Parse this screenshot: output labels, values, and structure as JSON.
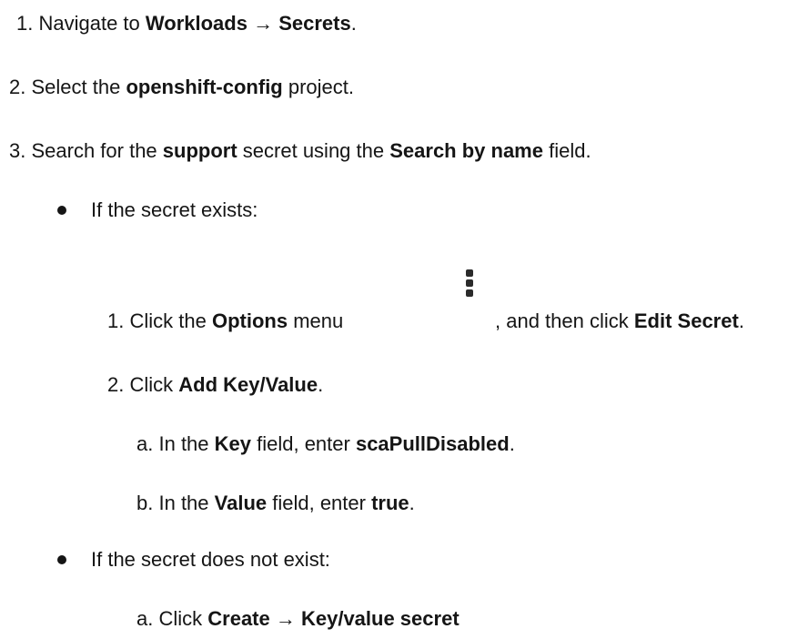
{
  "steps": [
    {
      "num": "1.",
      "pre": "Navigate to ",
      "bold1": "Workloads",
      "arrow": " → ",
      "bold2": "Secrets",
      "post": "."
    },
    {
      "num": "2.",
      "pre": "Select the ",
      "bold": "openshift-config",
      "post": " project."
    },
    {
      "num": "3.",
      "pre": "Search for the ",
      "bold1": "support",
      "mid": " secret using the ",
      "bold2": "Search by name",
      "post": " field."
    }
  ],
  "bullet_exists": {
    "text": "If the secret exists:",
    "substeps": [
      {
        "num": "1.",
        "pre": "Click the ",
        "bold1": "Options",
        "mid": " menu",
        "icon": "kebab-menu-icon",
        "mid2": ", and then click ",
        "bold2": "Edit Secret",
        "post": "."
      },
      {
        "num": "2.",
        "pre": "Click ",
        "bold": "Add Key/Value",
        "post": "."
      }
    ],
    "lettered": [
      {
        "letter": "a.",
        "pre": "In the ",
        "bold1": "Key",
        "mid": " field, enter ",
        "bold2": "scaPullDisabled",
        "post": "."
      },
      {
        "letter": "b.",
        "pre": "In the ",
        "bold1": "Value",
        "mid": " field, enter ",
        "bold2": "true",
        "post": "."
      }
    ]
  },
  "bullet_not_exists": {
    "text": "If the secret does not exist:",
    "lettered": [
      {
        "letter": "a.",
        "pre": "Click ",
        "bold": "Create → Key/value secret"
      }
    ]
  }
}
